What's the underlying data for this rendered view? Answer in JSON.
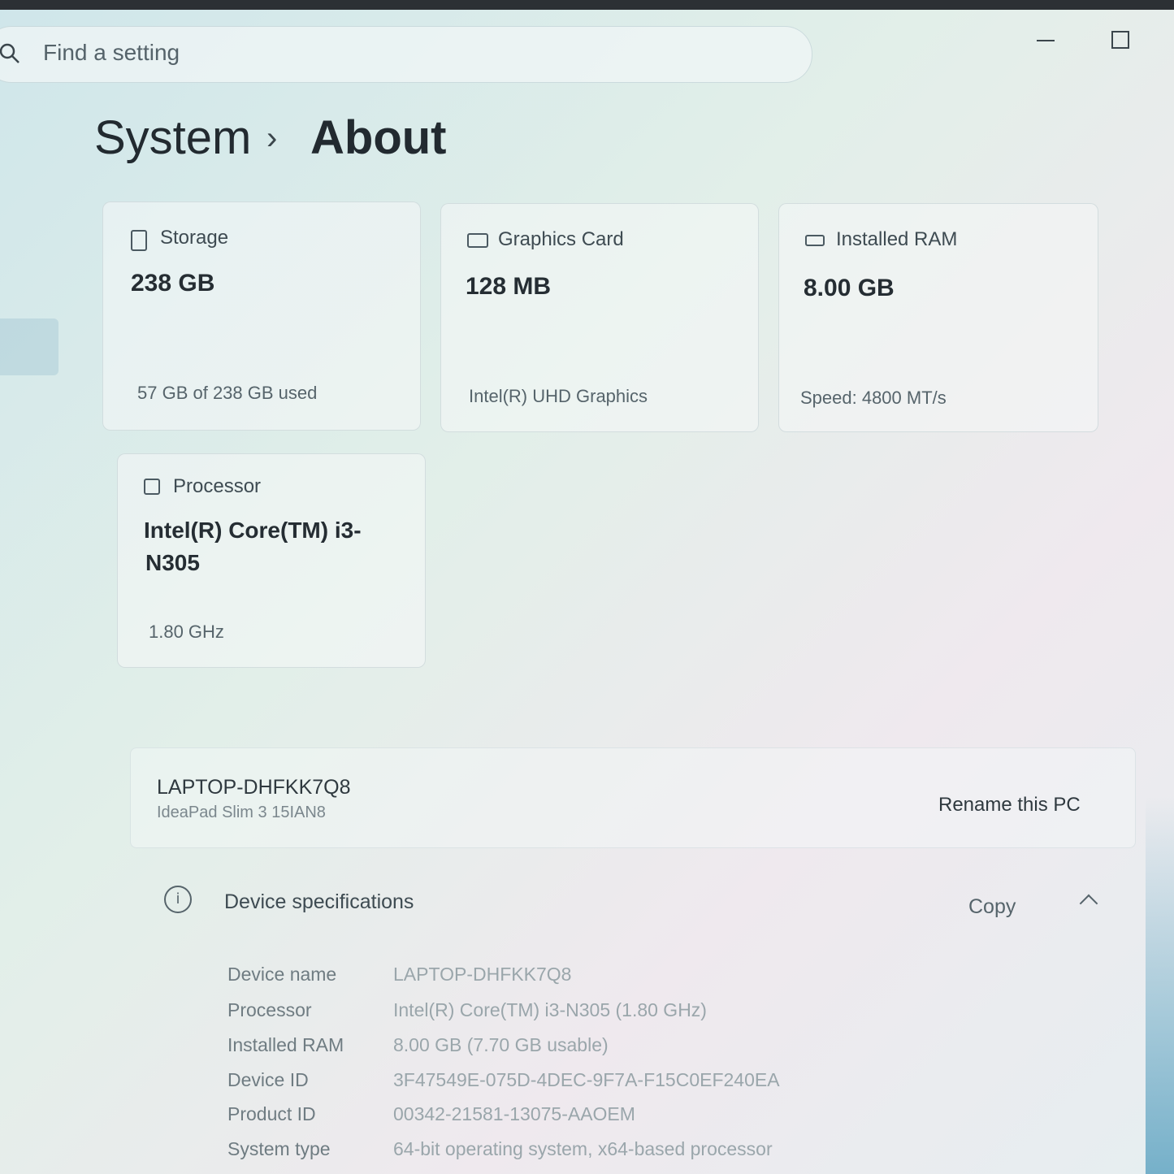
{
  "search": {
    "placeholder": "Find a setting"
  },
  "breadcrumb": {
    "parent": "System",
    "separator": "›",
    "current": "About"
  },
  "cards": {
    "storage": {
      "label": "Storage",
      "value": "238 GB",
      "sub": "57 GB of 238 GB used"
    },
    "graphics": {
      "label": "Graphics Card",
      "value": "128 MB",
      "sub": "Intel(R) UHD Graphics"
    },
    "ram": {
      "label": "Installed RAM",
      "value": "8.00 GB",
      "sub": "Speed: 4800 MT/s"
    },
    "processor": {
      "label": "Processor",
      "value_line1": "Intel(R) Core(TM) i3-",
      "value_line2": "N305",
      "sub": "1.80 GHz"
    }
  },
  "pc": {
    "name": "LAPTOP-DHFKK7Q8",
    "model": "IdeaPad Slim 3 15IAN8",
    "rename_label": "Rename this PC"
  },
  "specs": {
    "title": "Device specifications",
    "copy_label": "Copy",
    "rows": [
      {
        "key": "Device name",
        "value": "LAPTOP-DHFKK7Q8"
      },
      {
        "key": "Processor",
        "value": "Intel(R) Core(TM) i3-N305 (1.80 GHz)"
      },
      {
        "key": "Installed RAM",
        "value": "8.00 GB (7.70 GB usable)"
      },
      {
        "key": "Device ID",
        "value": "3F47549E-075D-4DEC-9F7A-F15C0EF240EA"
      },
      {
        "key": "Product ID",
        "value": "00342-21581-13075-AAOEM"
      },
      {
        "key": "System type",
        "value": "64-bit operating system, x64-based processor"
      }
    ]
  },
  "icons": {
    "search": "search-icon",
    "storage": "storage-icon",
    "graphics": "graphics-card-icon",
    "ram": "ram-icon",
    "processor": "processor-icon",
    "info": "info-icon",
    "chevron": "chevron-up-icon",
    "minimize": "minimize-icon",
    "maximize": "maximize-icon"
  }
}
